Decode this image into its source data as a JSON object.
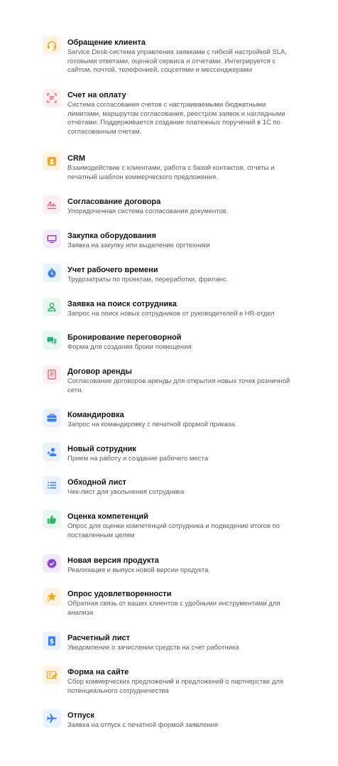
{
  "items": [
    {
      "title": "Обращение клиента",
      "desc": "Service Desk-система управления заявками с гибкой настройкой SLA, готовыми ответами, оценкой сервиса и отчетами. Интегрируется с сайтом, почтой, телефонией, соцсетями и мессенджерами",
      "icon": "headset-icon",
      "color": "#f5a623"
    },
    {
      "title": "Счет на оплату",
      "desc": "Система согласования счетов с настраиваемыми бюджетными лимитами, маршрутом согласования, реестром заявок и наглядными отчётами. Поддерживается создание платежных поручений в 1С по согласованным счетам.",
      "icon": "invoice-scan-icon",
      "color": "#ef5b6f"
    },
    {
      "title": "CRM",
      "desc": "Взаимодействие с клиентами, работа с базой контактов, отчеты и печатный шаблон коммерческого предложения.",
      "icon": "contact-card-icon",
      "color": "#f5a623"
    },
    {
      "title": "Согласование договора",
      "desc": "Упорядоченная система согласования документов.",
      "icon": "signature-icon",
      "color": "#ef5b6f"
    },
    {
      "title": "Закупка оборудования",
      "desc": "Заявка на закупку или выделение оргтехники",
      "icon": "monitor-icon",
      "color": "#9b3fd1"
    },
    {
      "title": "Учет рабочего времени",
      "desc": "Трудозатраты по проектам, переработки, фриланс.",
      "icon": "stopwatch-icon",
      "color": "#3b82f6"
    },
    {
      "title": "Заявка на поиск сотрудника",
      "desc": "Запрос на поиск новых сотрудников от руководителей в HR-отдел",
      "icon": "user-outline-icon",
      "color": "#2fb36b"
    },
    {
      "title": "Бронирование переговорной",
      "desc": "Форма для создания брони помещения",
      "icon": "chat-bubbles-icon",
      "color": "#22b07d"
    },
    {
      "title": "Договор аренды",
      "desc": "Согласование договоров аренды для открытия новых точек розничной сети.",
      "icon": "document-icon",
      "color": "#ef5b6f"
    },
    {
      "title": "Командировка",
      "desc": "Запрос на командировку с печатной формой приказа.",
      "icon": "briefcase-icon",
      "color": "#3b82f6"
    },
    {
      "title": "Новый сотрудник",
      "desc": "Прием на работу и создание рабочего места",
      "icon": "add-user-icon",
      "color": "#3b82f6"
    },
    {
      "title": "Обходной лист",
      "desc": "Чек-лист для увольнения сотрудника",
      "icon": "checklist-icon",
      "color": "#3b82f6"
    },
    {
      "title": "Оценка компетенций",
      "desc": "Опрос для оценки компетенций сотрудника и подведение итогов по поставленным целям",
      "icon": "thumbs-up-icon",
      "color": "#2fb36b"
    },
    {
      "title": "Новая версия продукта",
      "desc": "Реализация и выпуск новой версии продукта",
      "icon": "verified-badge-icon",
      "color": "#8b3fd9"
    },
    {
      "title": "Опрос удовлетворенности",
      "desc": "Обратная связь от ваших клиентов с удобными инструментами для анализа",
      "icon": "star-icon",
      "color": "#f5a623"
    },
    {
      "title": "Расчетный лист",
      "desc": "Уведомление о зачислении средств на счет работника",
      "icon": "dollar-icon",
      "color": "#3b82f6"
    },
    {
      "title": "Форма на сайте",
      "desc": "Сбор коммерческих предложений и предложений о партнерстве для потенциального сотрудничества",
      "icon": "web-form-icon",
      "color": "#f5a623"
    },
    {
      "title": "Отпуск",
      "desc": "Заявка на отпуск с печатной формой заявления",
      "icon": "airplane-icon",
      "color": "#3b82f6"
    }
  ]
}
